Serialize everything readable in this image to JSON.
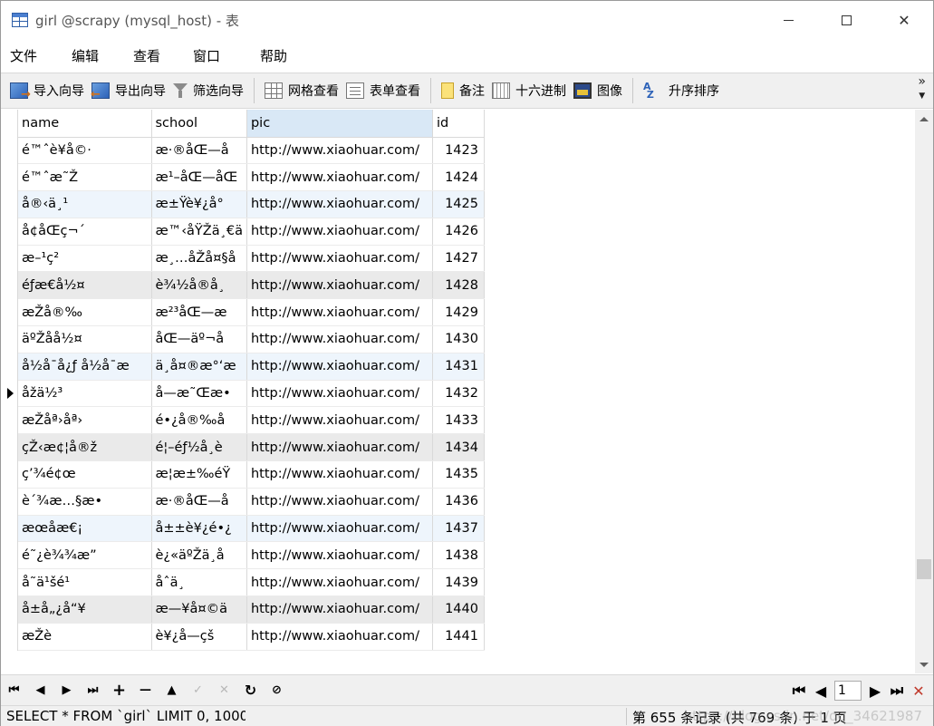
{
  "window": {
    "title": "girl @scrapy (mysql_host) - 表",
    "close_glyph": "✕"
  },
  "menu": [
    "文件",
    "编辑",
    "查看",
    "窗口",
    "帮助"
  ],
  "toolbar": {
    "import_wizard": "导入向导",
    "export_wizard": "导出向导",
    "filter_wizard": "筛选向导",
    "grid_view": "网格查看",
    "form_view": "表单查看",
    "memo": "备注",
    "hex": "十六进制",
    "image": "图像",
    "sort_ascending": "升序排序",
    "more_glyph": "»"
  },
  "table": {
    "columns": [
      "name",
      "school",
      "pic",
      "id"
    ],
    "selected_column": "pic",
    "current_row_id": "1432",
    "rows": [
      {
        "name": "é™ˆè¥å©·",
        "school": "æ·®åŒ—å",
        "pic": "http://www.xiaohuar.com/",
        "id": "1423",
        "shade": "white"
      },
      {
        "name": "é™ˆæ˜Ž",
        "school": "æ¹–åŒ—åŒ",
        "pic": "http://www.xiaohuar.com/",
        "id": "1424",
        "shade": "white"
      },
      {
        "name": "å®‹ä¸¹",
        "school": "æ±Ÿè¥¿å°",
        "pic": "http://www.xiaohuar.com/",
        "id": "1425",
        "shade": "blue"
      },
      {
        "name": "å¢åŒç¬´",
        "school": "æ™‹åŸŽä¸€ä",
        "pic": "http://www.xiaohuar.com/",
        "id": "1426",
        "shade": "white"
      },
      {
        "name": "æ–¹ç²",
        "school": "æ¸…åŽå¤§å",
        "pic": "http://www.xiaohuar.com/",
        "id": "1427",
        "shade": "white"
      },
      {
        "name": "éƒ­æ€å½¤",
        "school": "è¾½å®å¸",
        "pic": "http://www.xiaohuar.com/",
        "id": "1428",
        "shade": "gray"
      },
      {
        "name": "æŽå®‰",
        "school": "æ²³åŒ—æ",
        "pic": "http://www.xiaohuar.com/",
        "id": "1429",
        "shade": "white"
      },
      {
        "name": "äºŽå­å½¤",
        "school": "åŒ—äº¬å",
        "pic": "http://www.xiaohuar.com/",
        "id": "1430",
        "shade": "white"
      },
      {
        "name": "å½­å¯å¿ƒ å½­å¯æ",
        "school": "ä¸­å¤®æ°‘æ",
        "pic": "http://www.xiaohuar.com/",
        "id": "1431",
        "shade": "blue"
      },
      {
        "name": "åžä½³",
        "school": "å—æ˜Œæ•",
        "pic": "http://www.xiaohuar.com/",
        "id": "1432",
        "shade": "white"
      },
      {
        "name": "æŽåª›åª›",
        "school": "é•¿å®‰å",
        "pic": "http://www.xiaohuar.com/",
        "id": "1433",
        "shade": "white"
      },
      {
        "name": "çŽ‹æ¢¦å®ž",
        "school": "é¦–éƒ½å¸è",
        "pic": "http://www.xiaohuar.com/",
        "id": "1434",
        "shade": "gray"
      },
      {
        "name": "ç’¾é¢œ",
        "school": "æ­¦æ±‰éŸ",
        "pic": "http://www.xiaohuar.com/",
        "id": "1435",
        "shade": "white"
      },
      {
        "name": "è´¾æ…§æ•",
        "school": "æ·®åŒ—å",
        "pic": "http://www.xiaohuar.com/",
        "id": "1436",
        "shade": "white"
      },
      {
        "name": "æœå­æ€¡",
        "school": "å±±è¥¿é•¿",
        "pic": "http://www.xiaohuar.com/",
        "id": "1437",
        "shade": "blue"
      },
      {
        "name": "é˜¿è¾¾æ”",
        "school": "è¿«äºŽä¸­å",
        "pic": "http://www.xiaohuar.com/",
        "id": "1438",
        "shade": "white"
      },
      {
        "name": "å˜ä¹šé¹",
        "school": "åˆä¸­",
        "pic": "http://www.xiaohuar.com/",
        "id": "1439",
        "shade": "white"
      },
      {
        "name": "å±å„¿å“¥",
        "school": "æ—¥å¤©ä",
        "pic": "http://www.xiaohuar.com/",
        "id": "1440",
        "shade": "gray"
      },
      {
        "name": "æŽè",
        "school": "è¥¿å—çš",
        "pic": "http://www.xiaohuar.com/",
        "id": "1441",
        "shade": "white"
      }
    ]
  },
  "nav": {
    "first": "⏮",
    "prev": "◀",
    "next": "▶",
    "last": "⏭",
    "add": "+",
    "delete": "—",
    "up": "▲",
    "apply": "✓",
    "discard": "✕",
    "refresh": "↻",
    "stop": "⊘",
    "page_first": "⏮",
    "page_prev": "◀",
    "page_value": "1",
    "page_next": "▶",
    "page_last": "⏭",
    "settings": "✕"
  },
  "status": {
    "sql": "SELECT * FROM `girl` LIMIT 0, 1000",
    "records": "第 655 条记录 (共 769 条) 于 1 页",
    "watermark": "https://blog.csdn.net/qq_34621987"
  }
}
